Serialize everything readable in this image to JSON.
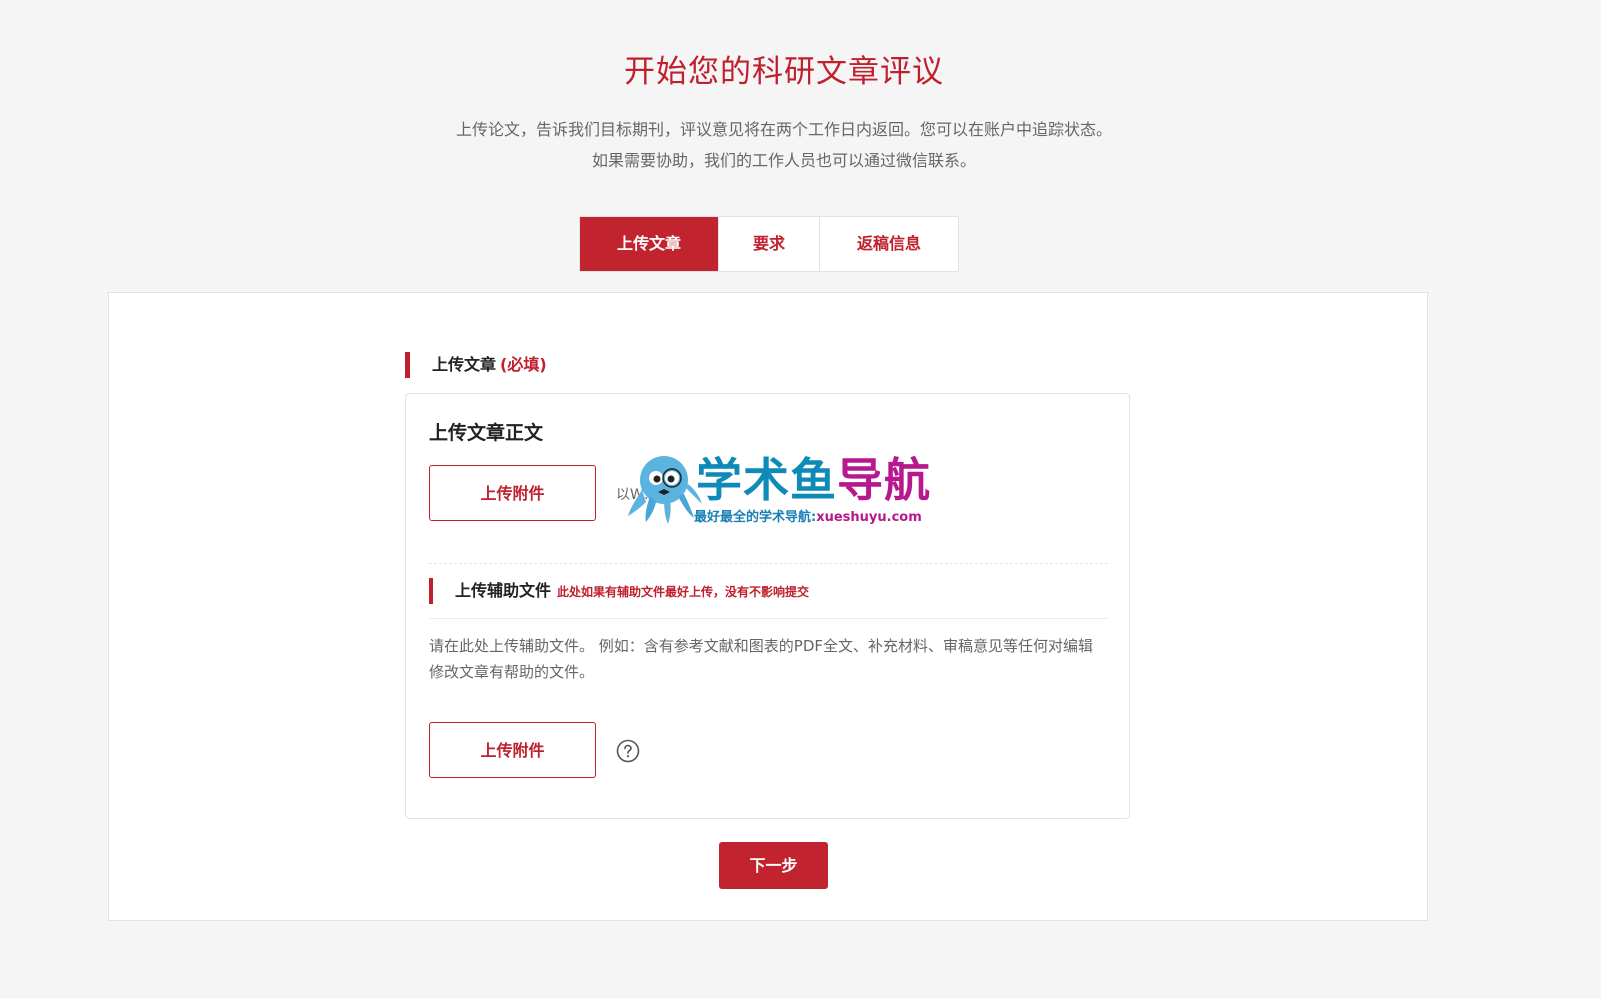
{
  "header": {
    "title": "开始您的科研文章评议",
    "intro_line1": "上传论文，告诉我们目标期刊，评议意见将在两个工作日内返回。您可以在账户中追踪状态。",
    "intro_line2": "如果需要协助，我们的工作人员也可以通过微信联系。"
  },
  "tabs": [
    {
      "label": "上传文章",
      "active": true
    },
    {
      "label": "要求",
      "active": false
    },
    {
      "label": "返稿信息",
      "active": false
    }
  ],
  "upload_section": {
    "heading": "上传文章",
    "required_tag": "(必填)",
    "body_title": "上传文章正文",
    "upload_button": "上传附件",
    "hint": "以W…"
  },
  "aux_section": {
    "heading": "上传辅助文件",
    "note": "此处如果有辅助文件最好上传，没有不影响提交",
    "description": "请在此处上传辅助文件。 例如：含有参考文献和图表的PDF全文、补充材料、审稿意见等任何对编辑修改文章有帮助的文件。",
    "upload_button": "上传附件",
    "help_icon": "question-circle-icon"
  },
  "next_button": "下一步",
  "watermark": {
    "title_part1": "学术鱼",
    "title_part2": "导航",
    "subtitle": "最好最全的学术导航:",
    "url": "xueshuyu.com"
  },
  "colors": {
    "brand_red": "#c1232f",
    "page_bg": "#f5f5f5",
    "watermark_blue": "#0d8ab8",
    "watermark_magenta": "#b8188e"
  }
}
